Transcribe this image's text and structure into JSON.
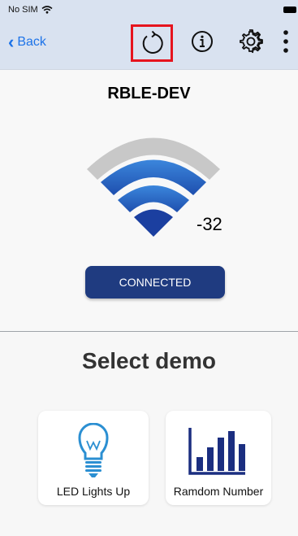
{
  "status_bar": {
    "carrier": "No SIM"
  },
  "nav": {
    "back_label": "Back"
  },
  "device": {
    "name": "RBLE-DEV",
    "rssi": "-32",
    "status_label": "CONNECTED"
  },
  "demo": {
    "title": "Select demo",
    "cards": [
      {
        "label": "LED Lights Up",
        "icon": "lightbulb-icon"
      },
      {
        "label": "Ramdom Number",
        "icon": "bar-chart-icon"
      }
    ]
  },
  "colors": {
    "nav_background": "#d9e2f0",
    "accent_blue": "#1d73e8",
    "connected_button": "#1f3b80",
    "highlight_red": "#e6141e",
    "signal_gray": "#c8c8c8",
    "signal_blue": "#2f73cc",
    "bulb_blue": "#2b8fd2",
    "chart_navy": "#1b2e80"
  }
}
